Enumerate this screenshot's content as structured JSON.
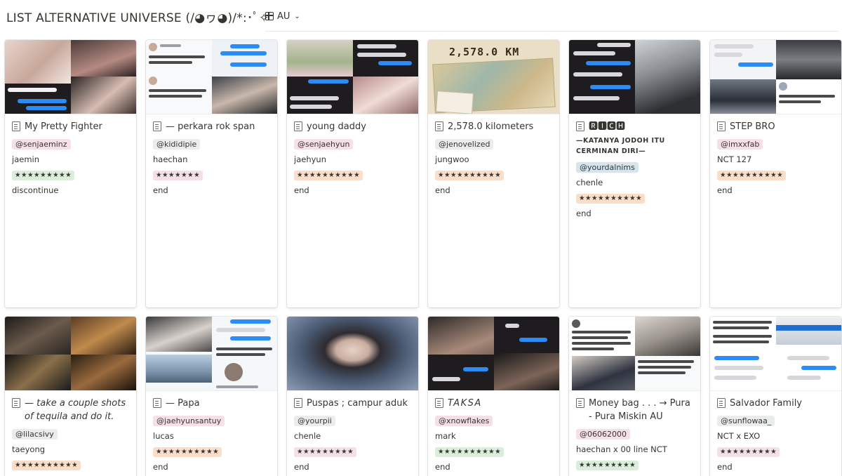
{
  "header": {
    "title": "LIST ALTERNATIVE UNIVERSE (/◕ヮ◕)/*:･ﾟ✧",
    "view_label": "AU",
    "view_icon": "gallery-grid-icon"
  },
  "cards": [
    {
      "title": "My Pretty Fighter",
      "author": "@senjaeminz",
      "author_color": "pink",
      "cast": "jaemin",
      "rating": "★★★★★★★★★",
      "rating_color": "green",
      "status": "discontinue"
    },
    {
      "title": "— perkara rok span",
      "author": "@kididipie",
      "author_color": "gray",
      "cast": "haechan",
      "rating": "★★★★★★★",
      "rating_color": "pink",
      "status": "end"
    },
    {
      "title": "young daddy",
      "author": "@senjaehyun",
      "author_color": "pink",
      "cast": "jaehyun",
      "rating": "★★★★★★★★★★",
      "rating_color": "orange",
      "status": "end"
    },
    {
      "title": "2,578.0 kilometers",
      "author": "@jenovelized",
      "author_color": "gray",
      "cast": "jungwoo",
      "rating": "★★★★★★★★★★",
      "rating_color": "orange",
      "status": "end"
    },
    {
      "title": "🆁🅸🅲🅷",
      "subtitle": "—KATANYA JODOH ITU CERMINAN DIRI—",
      "author": "@yourdalnims",
      "author_color": "blue",
      "cast": "chenle",
      "rating": "★★★★★★★★★★",
      "rating_color": "orange",
      "status": "end"
    },
    {
      "title": "STEP BRO",
      "author": "@imxxfab",
      "author_color": "pink",
      "cast": "NCT 127",
      "rating": "★★★★★★★★★★",
      "rating_color": "orange",
      "status": "end"
    },
    {
      "title": "— take a couple shots of tequila and do it.",
      "author": "@lilacsivy",
      "author_color": "gray",
      "cast": "taeyong",
      "rating": "★★★★★★★★★★",
      "rating_color": "orange",
      "status": ""
    },
    {
      "title": "— Papa",
      "author": "@jaehyunsantuy",
      "author_color": "pink",
      "cast": "lucas",
      "rating": "★★★★★★★★★★",
      "rating_color": "orange",
      "status": "end"
    },
    {
      "title": "Puspas ; campur aduk",
      "author": "@yourpii",
      "author_color": "gray",
      "cast": "chenle",
      "rating": "★★★★★★★★★",
      "rating_color": "pink",
      "status": "end"
    },
    {
      "title": "TAKSA",
      "author": "@xnowflakes",
      "author_color": "pink",
      "cast": "mark",
      "rating": "★★★★★★★★★★",
      "rating_color": "green",
      "status": "end"
    },
    {
      "title": "Money bag . . . → Pura - Pura Miskin AU",
      "author": "@06062000",
      "author_color": "pink",
      "cast": "haechan x 00 line NCT",
      "rating": "★★★★★★★★★",
      "rating_color": "green",
      "status": ""
    },
    {
      "title": "Salvador Family",
      "author": "@sunflowaa_",
      "author_color": "gray",
      "cast": "NCT x EXO",
      "rating": "★★★★★★★★★",
      "rating_color": "pink",
      "status": "end"
    }
  ],
  "covers": {
    "card4_text": "2,578.0 KM"
  },
  "colors": {
    "tag_pink": "#f5e0e9",
    "tag_gray": "#ebeced",
    "tag_blue": "#d3e5ef",
    "rating_green": "#dbeddb",
    "rating_orange": "#fadec9"
  }
}
